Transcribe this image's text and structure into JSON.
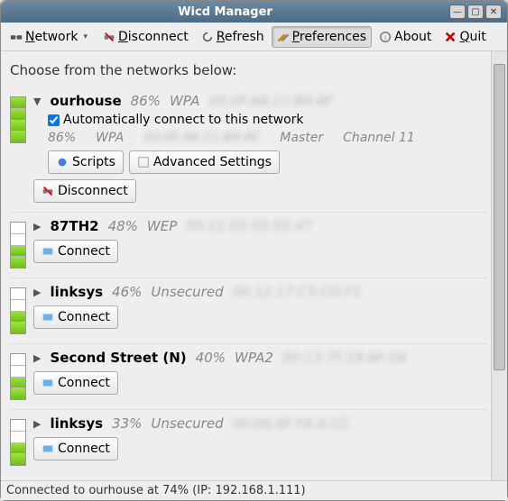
{
  "window": {
    "title": "Wicd Manager"
  },
  "toolbar": {
    "network": "Network",
    "disconnect": "Disconnect",
    "refresh": "Refresh",
    "preferences": "Preferences",
    "about": "About",
    "quit": "Quit"
  },
  "prompt": "Choose from the networks below:",
  "networks": [
    {
      "ssid": "ourhouse",
      "pct": "86%",
      "enc": "WPA",
      "expanded": true,
      "autoconnect_checked": true,
      "autoconnect_label": "Automatically connect to this network",
      "info_pct": "86%",
      "info_enc": "WPA",
      "info_mode": "Master",
      "info_channel": "Channel 11",
      "scripts": "Scripts",
      "advanced": "Advanced Settings",
      "action": "Disconnect",
      "signal": 4
    },
    {
      "ssid": "87TH2",
      "pct": "48%",
      "enc": "WEP",
      "expanded": false,
      "action": "Connect",
      "signal": 2
    },
    {
      "ssid": "linksys",
      "pct": "46%",
      "enc": "Unsecured",
      "expanded": false,
      "action": "Connect",
      "signal": 2
    },
    {
      "ssid": "Second Street (N)",
      "pct": "40%",
      "enc": "WPA2",
      "expanded": false,
      "action": "Connect",
      "signal": 2
    },
    {
      "ssid": "linksys",
      "pct": "33%",
      "enc": "Unsecured",
      "expanded": false,
      "action": "Connect",
      "signal": 2
    }
  ],
  "status": "Connected to ourhouse at 74% (IP: 192.168.1.111)"
}
